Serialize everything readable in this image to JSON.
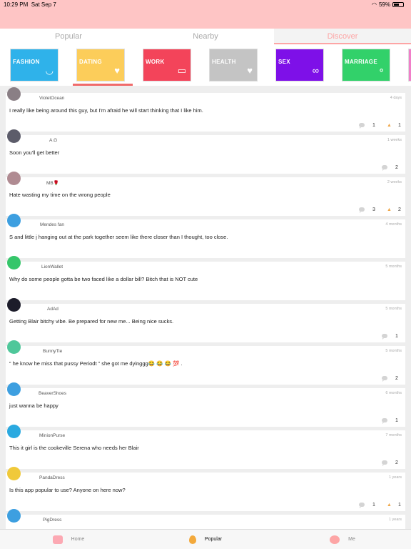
{
  "status_bar": {
    "time": "10:29 PM",
    "date": "Sat Sep 7",
    "battery": "59%"
  },
  "tabs": [
    {
      "label": "Popular",
      "active": false
    },
    {
      "label": "Nearby",
      "active": false
    },
    {
      "label": "Discover",
      "active": true
    }
  ],
  "categories": [
    {
      "label": "FASHION",
      "color": "#2fb2ea",
      "icon": "handbag-icon",
      "glyph": "◡"
    },
    {
      "label": "DATING",
      "color": "#fccd5a",
      "icon": "heart-icon",
      "glyph": "♥"
    },
    {
      "label": "WORK",
      "color": "#f3445a",
      "icon": "id-card-icon",
      "glyph": "▭"
    },
    {
      "label": "HEALTH",
      "color": "#c4c4c4",
      "icon": "heart-pulse-icon",
      "glyph": "♥"
    },
    {
      "label": "SEX",
      "color": "#7e10e8",
      "icon": "bra-icon",
      "glyph": "∞"
    },
    {
      "label": "MARRIAGE",
      "color": "#32d16a",
      "icon": "rings-icon",
      "glyph": "⚬"
    }
  ],
  "posts": [
    {
      "name": "VioletOcean",
      "time": "4 days",
      "text": "I really like being around this guy, but I'm afraid he will start thinking that I like him.",
      "comments": "1",
      "hot": "1",
      "avatar_color": "#8a7f85"
    },
    {
      "name": "A.G",
      "time": "1 weeks",
      "text": "Soon you'll get better",
      "comments": "2",
      "hot": "",
      "avatar_color": "#5c5c6a"
    },
    {
      "name": "MB🌹",
      "time": "2 weeks",
      "text": "Hate wasting my time on the wrong people",
      "comments": "3",
      "hot": "2",
      "avatar_color": "#b08b92"
    },
    {
      "name": "Mendes fan",
      "time": "4 months",
      "text": "S and little j hanging out at the park together seem like there closer than I thought, too close.",
      "comments": "",
      "hot": "",
      "avatar_color": "#3d9fe0"
    },
    {
      "name": "LionWallet",
      "time": "5 months",
      "text": "Why do some people gotta be two faced like a dollar bill? Bitch that is NOT cute",
      "comments": "",
      "hot": "",
      "avatar_color": "#35c66a"
    },
    {
      "name": "AdAd",
      "time": "5 months",
      "text": "Getting Blair bitchy vibe. Be prepared for new me... Being nice sucks.",
      "comments": "1",
      "hot": "",
      "avatar_color": "#1c1c2a"
    },
    {
      "name": "BunnyTie",
      "time": "5 months",
      "text": "“ he know he miss that pussy Periodt ” she got me dyinggg😂 😂 😂 💯 .",
      "comments": "2",
      "hot": "",
      "avatar_color": "#4fc79a"
    },
    {
      "name": "BeaverShoes",
      "time": "6 months",
      "text": "just wanna be happy",
      "comments": "1",
      "hot": "",
      "avatar_color": "#3d9fe0"
    },
    {
      "name": "MinionPurse",
      "time": "7 months",
      "text": "This it girl is the cookeville Serena who needs her Blair",
      "comments": "2",
      "hot": "",
      "avatar_color": "#2aa9e0"
    },
    {
      "name": "PandaDress",
      "time": "1 years",
      "text": "Is this app popular to use? Anyone on here now?",
      "comments": "1",
      "hot": "1",
      "avatar_color": "#f0c93a"
    },
    {
      "name": "PigDress",
      "time": "1 years",
      "text": "",
      "comments": "",
      "hot": "",
      "avatar_color": "#3d9fe0"
    }
  ],
  "bottom_nav": [
    {
      "label": "Home",
      "icon": "home-poop-icon",
      "color": "#fca9b3",
      "active": false
    },
    {
      "label": "Popular",
      "icon": "flame-icon",
      "color": "#f3a93b",
      "active": true
    },
    {
      "label": "Me",
      "icon": "profile-icon",
      "color": "#fda5a5",
      "active": false
    }
  ]
}
